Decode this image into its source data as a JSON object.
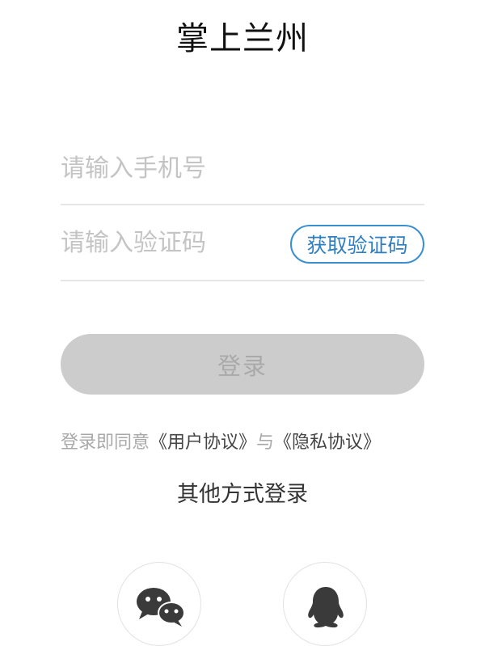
{
  "app": {
    "title": "掌上兰州"
  },
  "login_form": {
    "phone_placeholder": "请输入手机号",
    "phone_value": "",
    "code_placeholder": "请输入验证码",
    "code_value": "",
    "get_code_label": "获取验证码",
    "login_label": "登录"
  },
  "agreement": {
    "prefix": "登录即同意",
    "user_agreement": "《用户协议》",
    "connector": "与",
    "privacy_agreement": "《隐私协议》"
  },
  "other_login": {
    "title": "其他方式登录",
    "options": [
      {
        "name": "wechat",
        "icon": "wechat-icon"
      },
      {
        "name": "qq",
        "icon": "qq-icon"
      }
    ]
  },
  "colors": {
    "accent": "#2e7fc2",
    "disabled_button": "#cccccc",
    "placeholder": "#c4c4c4",
    "divider": "#e6e6e6"
  }
}
